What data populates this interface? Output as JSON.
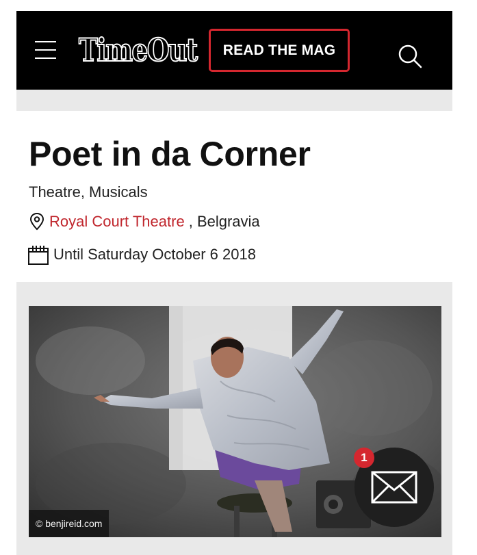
{
  "header": {
    "logo_text": "TimeOut",
    "read_mag_label": "READ THE MAG",
    "accent_color": "#d5272f",
    "menu_icon": "hamburger-menu-icon",
    "search_icon": "search-icon"
  },
  "event": {
    "title": "Poet in da Corner",
    "category": "Theatre, Musicals",
    "venue": "Royal Court Theatre",
    "venue_separator": ",",
    "area": "Belgravia",
    "dates": "Until Saturday October 6 2018",
    "venue_icon": "map-pin-icon",
    "date_icon": "calendar-icon"
  },
  "image": {
    "credit": "© benjireid.com"
  },
  "mail": {
    "badge_count": "1",
    "icon": "envelope-icon"
  }
}
